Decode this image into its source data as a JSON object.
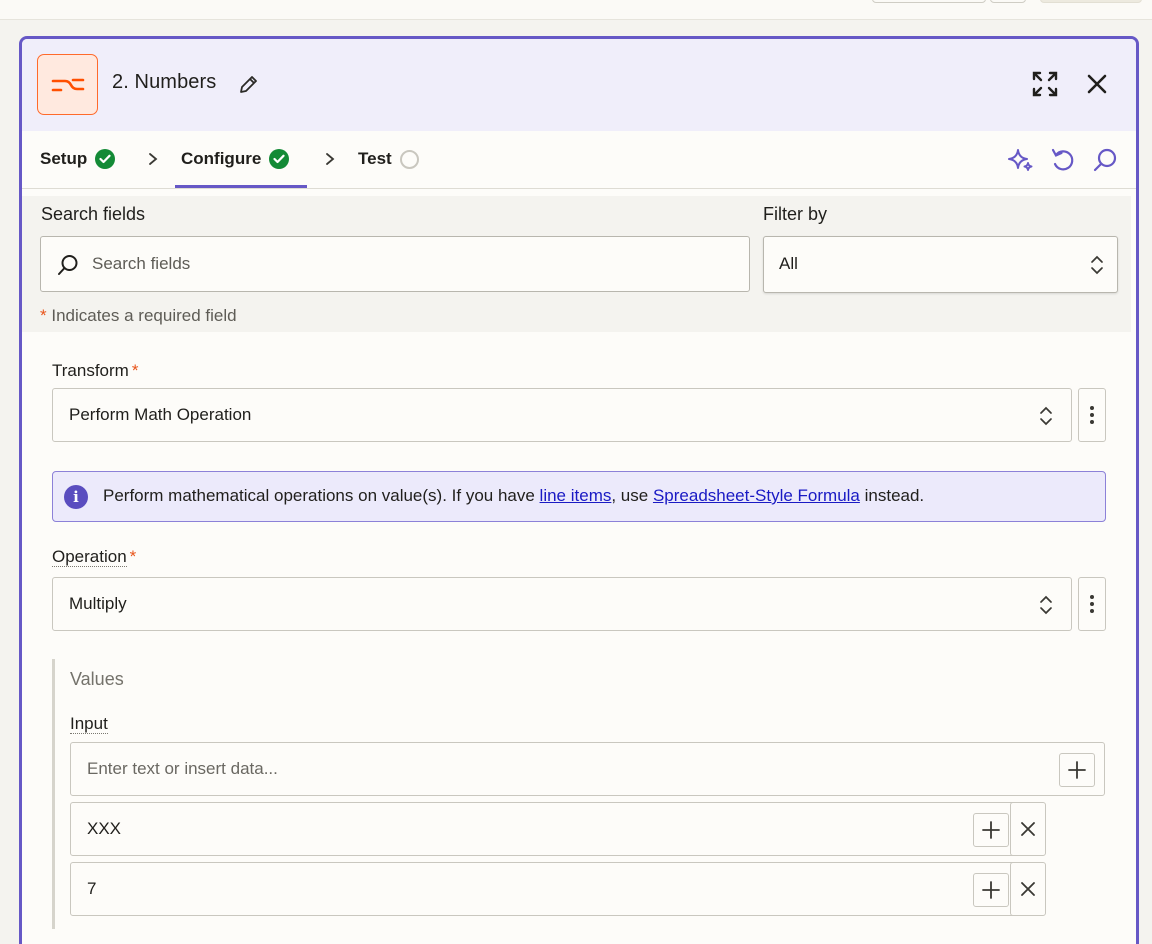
{
  "header": {
    "title": "2. Numbers",
    "icon": "numbers-formatter-icon",
    "accent": "#6658c6",
    "icon_color": "#ff6a2b"
  },
  "tabs": [
    {
      "label": "Setup",
      "status": "complete"
    },
    {
      "label": "Configure",
      "status": "complete",
      "active": true
    },
    {
      "label": "Test",
      "status": "pending"
    }
  ],
  "search": {
    "label": "Search fields",
    "placeholder": "Search fields"
  },
  "filter": {
    "label": "Filter by",
    "value": "All"
  },
  "required_note": {
    "star": "*",
    "text": " Indicates a required field"
  },
  "transform": {
    "label": "Transform",
    "required": "*",
    "value": "Perform Math Operation"
  },
  "info": {
    "text_before": "Perform mathematical operations on value(s). If you have ",
    "link1": "line items",
    "text_middle": ", use ",
    "link2": "Spreadsheet-Style Formula",
    "text_after": " instead."
  },
  "operation": {
    "label": "Operation",
    "required": "*",
    "value": "Multiply"
  },
  "values": {
    "title": "Values",
    "input_label": "Input",
    "placeholder": "Enter text or insert data...",
    "items": [
      "XXX",
      "7"
    ]
  }
}
